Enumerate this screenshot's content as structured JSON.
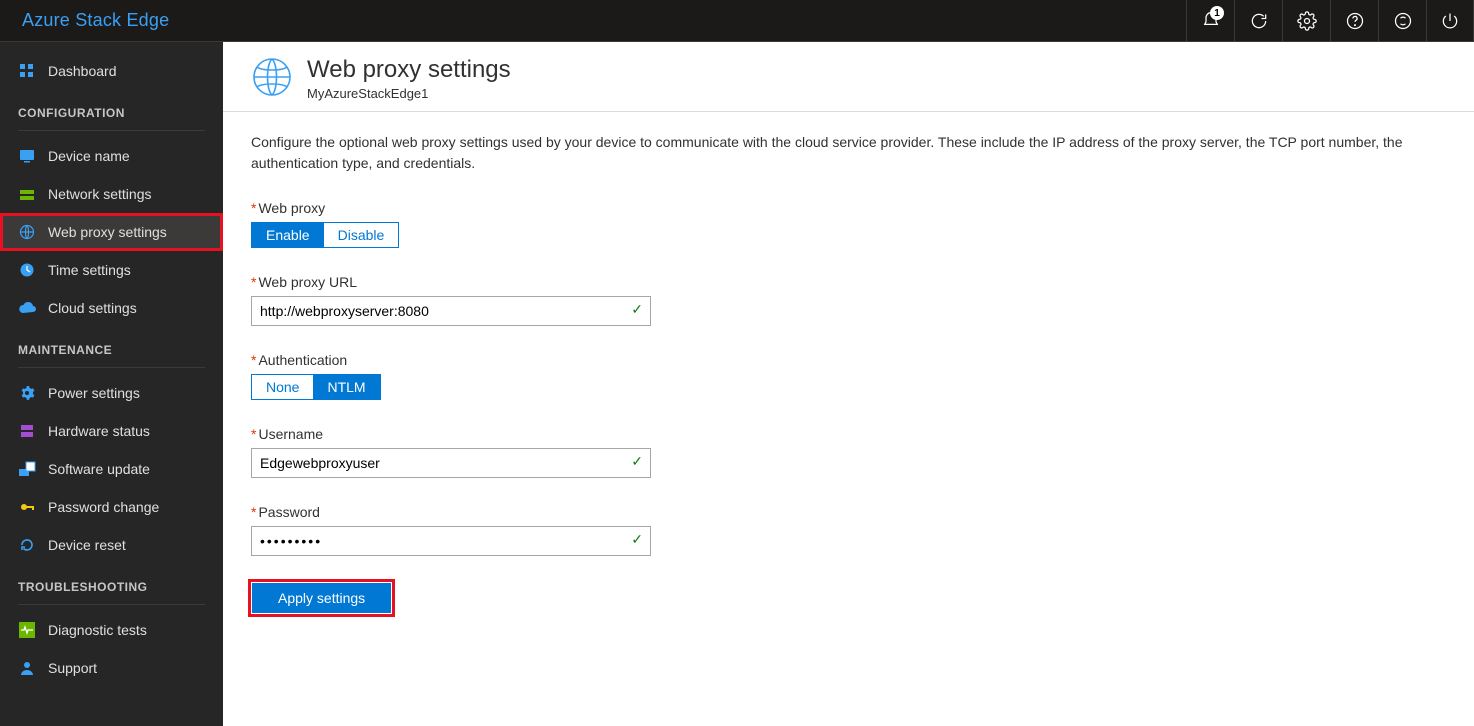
{
  "header": {
    "brand": "Azure Stack Edge",
    "notification_count": "1"
  },
  "sidebar": {
    "dashboard": "Dashboard",
    "section_configuration": "CONFIGURATION",
    "items_config": {
      "device_name": "Device name",
      "network_settings": "Network settings",
      "web_proxy_settings": "Web proxy settings",
      "time_settings": "Time settings",
      "cloud_settings": "Cloud settings"
    },
    "section_maintenance": "MAINTENANCE",
    "items_maint": {
      "power_settings": "Power settings",
      "hardware_status": "Hardware status",
      "software_update": "Software update",
      "password_change": "Password change",
      "device_reset": "Device reset"
    },
    "section_troubleshoot": "TROUBLESHOOTING",
    "items_trouble": {
      "diagnostic_tests": "Diagnostic tests",
      "support": "Support"
    }
  },
  "page": {
    "title": "Web proxy settings",
    "subtitle": "MyAzureStackEdge1",
    "intro": "Configure the optional web proxy settings used by your device to communicate with the cloud service provider. These include the IP address of the proxy server, the TCP port number, the authentication type, and credentials."
  },
  "form": {
    "web_proxy_label": "Web proxy",
    "enable": "Enable",
    "disable": "Disable",
    "url_label": "Web proxy URL",
    "url_value": "http://webproxyserver:8080",
    "auth_label": "Authentication",
    "auth_none": "None",
    "auth_ntlm": "NTLM",
    "username_label": "Username",
    "username_value": "Edgewebproxyuser",
    "password_label": "Password",
    "password_value": "•••••••••",
    "apply_label": "Apply settings"
  }
}
